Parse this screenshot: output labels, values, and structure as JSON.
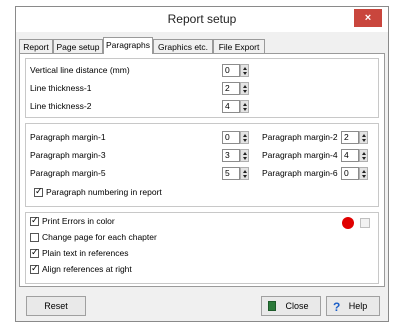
{
  "window": {
    "title": "Report setup",
    "close_glyph": "×"
  },
  "tabs": [
    "Report",
    "Page setup",
    "Paragraphs",
    "Graphics etc.",
    "File Export"
  ],
  "active_tab": "Paragraphs",
  "lines": {
    "vertical_label": "Vertical line distance (mm)",
    "vertical_value": "0",
    "thick1_label": "Line thickness-1",
    "thick1_value": "2",
    "thick2_label": "Line thickness-2",
    "thick2_value": "4"
  },
  "margins": {
    "m1_label": "Paragraph margin-1",
    "m1_value": "0",
    "m2_label": "Paragraph margin-2",
    "m2_value": "2",
    "m3_label": "Paragraph margin-3",
    "m3_value": "3",
    "m4_label": "Paragraph margin-4",
    "m4_value": "4",
    "m5_label": "Paragraph margin-5",
    "m5_value": "5",
    "m6_label": "Paragraph margin-6",
    "m6_value": "0",
    "numbering_label": "Paragraph numbering in report",
    "numbering_checked": true
  },
  "options": {
    "print_errors_label": "Print Errors in color",
    "print_errors_checked": true,
    "change_page_label": "Change page for each chapter",
    "change_page_checked": false,
    "plain_text_label": "Plain text in references",
    "plain_text_checked": true,
    "align_refs_label": "Align references at right",
    "align_refs_checked": true,
    "error_color": "#e00000"
  },
  "buttons": {
    "reset": "Reset",
    "close": "Close",
    "help": "Help"
  },
  "icons": {
    "close_button_icon": "door-exit-icon",
    "help_button_icon": "question-mark-icon"
  }
}
